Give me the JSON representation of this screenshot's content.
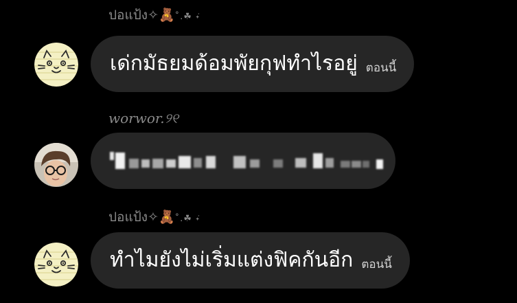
{
  "messages": [
    {
      "sender": "ปอแป้ง✧",
      "sender_emoji": "🧸",
      "sender_deco": "˚.☘︎ ݁˖",
      "text": "เด่กมัธยมด้อมพัยกุฟทำไรอยู่",
      "time": "ตอนนี้",
      "avatar": "cat-sticker"
    },
    {
      "sender": "worwor.୨୧",
      "sender_emoji": "",
      "sender_deco": "",
      "text": "",
      "time": "",
      "avatar": "boy-photo"
    },
    {
      "sender": "ปอแป้ง✧",
      "sender_emoji": "🧸",
      "sender_deco": "˚.☘︎ ݁˖",
      "text": "ทำไมยังไม่เริ่มแต่งฟิคกันอีก",
      "time": "ตอนนี้",
      "avatar": "cat-sticker"
    }
  ],
  "colors": {
    "background": "#000000",
    "bubble": "#262626",
    "sender_text": "#8a8a8a",
    "avatar_yellow": "#f4f0c4"
  }
}
